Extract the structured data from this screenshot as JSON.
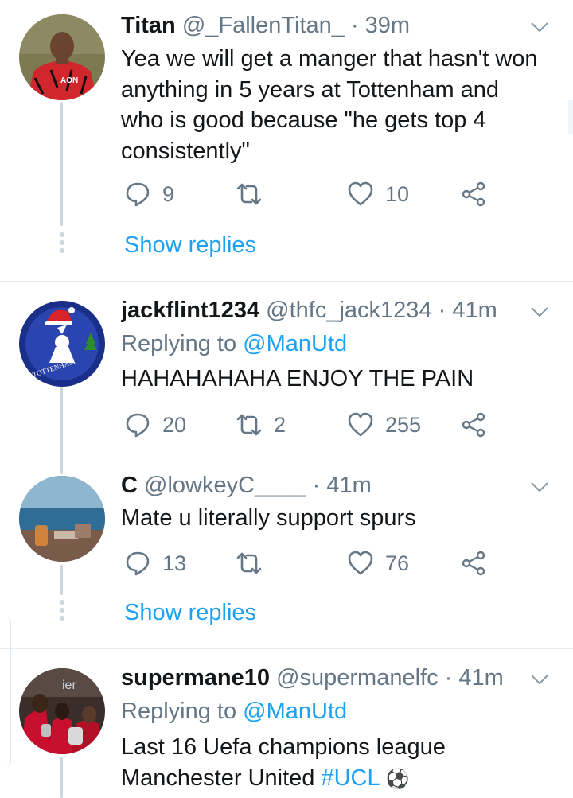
{
  "tweets": [
    {
      "name": "Titan",
      "handle": "@_FallenTitan_",
      "time": "· 39m",
      "text_lines": [
        "Yea we will get a manger that hasn't won",
        "anything in 5 years at Tottenham and",
        "who is good because \"he gets top 4",
        "consistently\""
      ],
      "replies": "9",
      "retweets": "",
      "likes": "10",
      "show_replies": "Show replies"
    },
    {
      "name": "jackflint1234",
      "handle": "@thfc_jack1234",
      "time": "· 41m",
      "replying_prefix": "Replying to",
      "replying_mention": "@ManUtd",
      "text_lines": [
        "HAHAHAHAHA ENJOY THE PAIN"
      ],
      "replies": "20",
      "retweets": "2",
      "likes": "255",
      "avatar_text": "TOTTENHAM"
    },
    {
      "name": "C",
      "handle": "@lowkeyC____",
      "time": "· 41m",
      "text_lines": [
        "Mate u literally support spurs"
      ],
      "replies": "13",
      "retweets": "",
      "likes": "76",
      "show_replies": "Show replies"
    },
    {
      "name": "supermane10",
      "handle": "@supermanelfc",
      "time": "· 41m",
      "replying_prefix": "Replying to",
      "replying_mention": "@ManUtd",
      "text_lines": [
        "Last 16 Uefa champions league"
      ],
      "text_line2_prefix": "Manchester United",
      "hashtag": "#UCL",
      "emoji": "⚽"
    }
  ],
  "icons": {
    "reply": "reply-icon",
    "retweet": "retweet-icon",
    "like": "heart-icon",
    "share": "share-icon",
    "caret": "chevron-down-icon"
  },
  "colors": {
    "accent": "#1da1f2",
    "secondary_text": "#657786",
    "primary_text": "#14171a",
    "thread_line": "#ccd6dd",
    "divider": "#e6ecf0"
  }
}
